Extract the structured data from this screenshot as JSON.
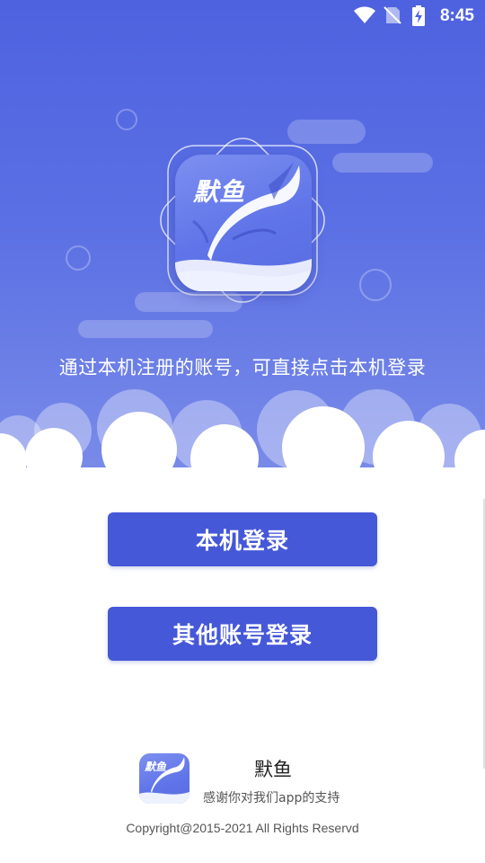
{
  "status_bar": {
    "time": "8:45",
    "icons": [
      "wifi-icon",
      "no-sim-icon",
      "battery-charging-icon"
    ]
  },
  "header": {
    "app_logo_text": "默鱼",
    "tagline": "通过本机注册的账号，可直接点击本机登录"
  },
  "actions": {
    "local_login_label": "本机登录",
    "other_login_label": "其他账号登录"
  },
  "footer": {
    "logo_text": "默鱼",
    "app_name": "默鱼",
    "thanks": "感谢你对我们app的支持",
    "copyright": "Copyright@2015-2021 All Rights Reservd"
  },
  "colors": {
    "hero_top": "#4e62e0",
    "hero_bottom": "#7d8ee9",
    "button": "#4558d8",
    "button_text": "#ffffff"
  }
}
